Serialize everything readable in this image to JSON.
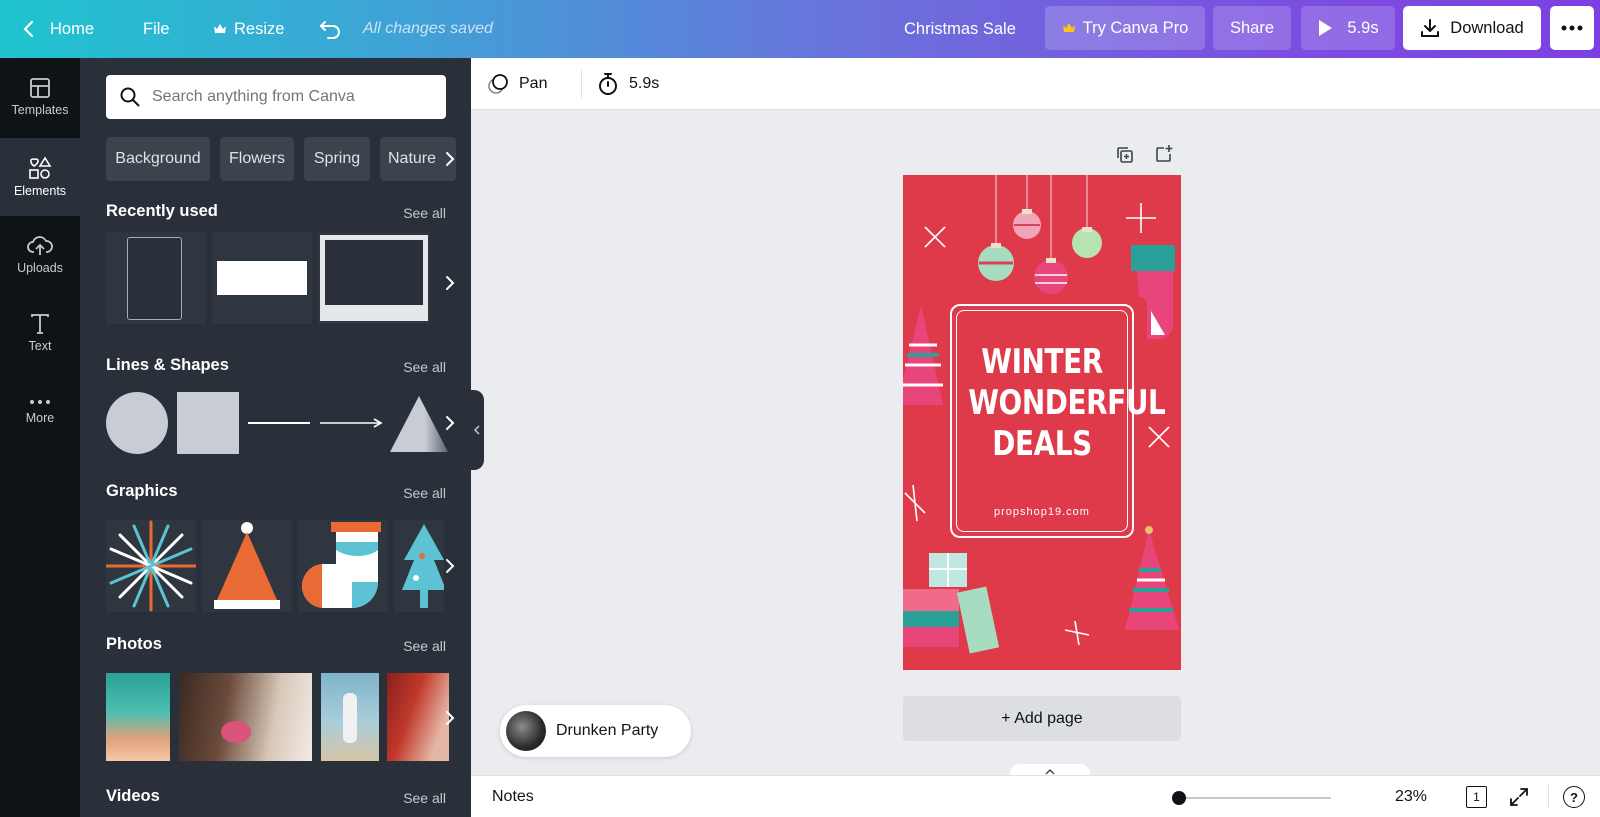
{
  "topbar": {
    "home": "Home",
    "file": "File",
    "resize": "Resize",
    "saved": "All changes saved",
    "title": "Christmas Sale",
    "try_pro": "Try Canva Pro",
    "share": "Share",
    "play_duration": "5.9s",
    "download": "Download"
  },
  "rail": {
    "templates": "Templates",
    "elements": "Elements",
    "uploads": "Uploads",
    "text": "Text",
    "more": "More"
  },
  "panel": {
    "search_placeholder": "Search anything from Canva",
    "chips": [
      "Background",
      "Flowers",
      "Spring",
      "Nature"
    ],
    "sections": {
      "recent": "Recently used",
      "shapes": "Lines & Shapes",
      "graphics": "Graphics",
      "photos": "Photos",
      "videos": "Videos"
    },
    "see_all": "See all"
  },
  "toolbar": {
    "pan": "Pan",
    "duration": "5.9s"
  },
  "design": {
    "line1": "WINTER",
    "line2": "WONDERFUL",
    "line3": "DEALS",
    "url": "propshop19.com",
    "background_color": "#de3a4a"
  },
  "add_page": "+ Add page",
  "audio": {
    "track": "Drunken Party"
  },
  "bottombar": {
    "notes": "Notes",
    "zoom": "23%",
    "zoom_level": 0.23,
    "page_count": "1",
    "help": "?"
  },
  "colors": {
    "accent_gradient_start": "#1fc4cf",
    "accent_gradient_end": "#7d3fe2",
    "panel_bg": "#293039",
    "rail_bg": "#0e1318"
  }
}
